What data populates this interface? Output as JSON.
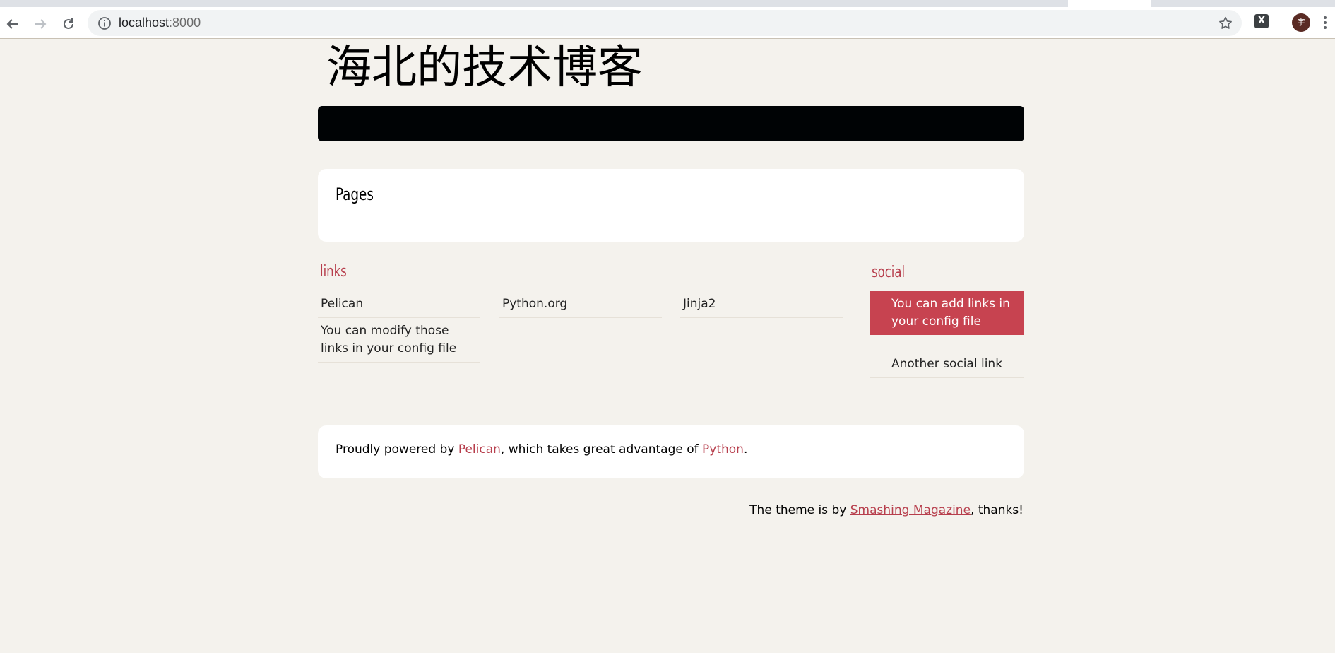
{
  "browser": {
    "url_host": "localhost",
    "url_port": ":8000",
    "avatar_initial": "宇",
    "extension_label": "X"
  },
  "site": {
    "title": "海北的技术博客"
  },
  "pages": {
    "heading": "Pages"
  },
  "links": {
    "heading": "links",
    "items": [
      {
        "label": "Pelican"
      },
      {
        "label": "Python.org"
      },
      {
        "label": "Jinja2"
      },
      {
        "label": "You can modify those links in your config file"
      }
    ]
  },
  "social": {
    "heading": "social",
    "items": [
      {
        "label": "You can add links in your config file"
      },
      {
        "label": "Another social link"
      }
    ]
  },
  "footer": {
    "powered_prefix": "Proudly powered by ",
    "pelican_link": "Pelican",
    "powered_middle": ", which takes great advantage of ",
    "python_link": "Python",
    "powered_suffix": ".",
    "theme_prefix": "The theme is by ",
    "theme_link": "Smashing Magazine",
    "theme_suffix": ", thanks!"
  },
  "colors": {
    "background": "#f4f2ed",
    "accent": "#b73e4c",
    "active_social": "#c74350",
    "navbar": "#000305"
  }
}
